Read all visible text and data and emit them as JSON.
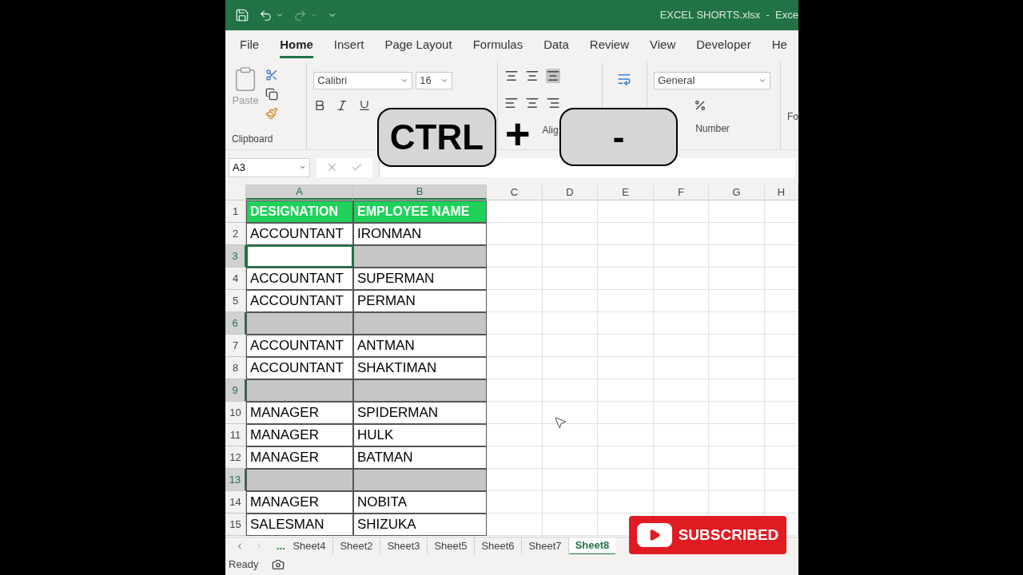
{
  "title_bar": {
    "title": "EXCEL SHORTS.xlsx  -  Exce"
  },
  "menu_tabs": [
    {
      "label": "File",
      "selected": false
    },
    {
      "label": "Home",
      "selected": true
    },
    {
      "label": "Insert",
      "selected": false
    },
    {
      "label": "Page Layout",
      "selected": false
    },
    {
      "label": "Formulas",
      "selected": false
    },
    {
      "label": "Data",
      "selected": false
    },
    {
      "label": "Review",
      "selected": false
    },
    {
      "label": "View",
      "selected": false
    },
    {
      "label": "Developer",
      "selected": false
    },
    {
      "label": "He",
      "selected": false
    }
  ],
  "ribbon": {
    "paste_label": "Paste",
    "font_name": "Calibri",
    "font_size": "16",
    "number_format": "General",
    "cut_off_label": "Fo",
    "groups": [
      "Clipboard",
      "Alig",
      "Number"
    ]
  },
  "formula_bar": {
    "name_box": "A3"
  },
  "columns": [
    {
      "label": "A",
      "selected": true
    },
    {
      "label": "B",
      "selected": true
    },
    {
      "label": "C",
      "selected": false
    },
    {
      "label": "D",
      "selected": false
    },
    {
      "label": "E",
      "selected": false
    },
    {
      "label": "F",
      "selected": false
    },
    {
      "label": "G",
      "selected": false
    },
    {
      "label": "H",
      "selected": false
    }
  ],
  "rows": [
    {
      "number": "1",
      "kind": "header",
      "selected": false,
      "active": false,
      "cells": [
        "DESIGNATION",
        "EMPLOYEE NAME"
      ]
    },
    {
      "number": "2",
      "kind": "data",
      "selected": false,
      "active": false,
      "cells": [
        "ACCOUNTANT",
        "IRONMAN"
      ]
    },
    {
      "number": "3",
      "kind": "data",
      "selected": true,
      "active": true,
      "cells": []
    },
    {
      "number": "4",
      "kind": "data",
      "selected": false,
      "active": false,
      "cells": [
        "ACCOUNTANT",
        "SUPERMAN"
      ]
    },
    {
      "number": "5",
      "kind": "data",
      "selected": false,
      "active": false,
      "cells": [
        "ACCOUNTANT",
        "PERMAN"
      ]
    },
    {
      "number": "6",
      "kind": "data",
      "selected": true,
      "active": false,
      "cells": []
    },
    {
      "number": "7",
      "kind": "data",
      "selected": false,
      "active": false,
      "cells": [
        "ACCOUNTANT",
        "ANTMAN"
      ]
    },
    {
      "number": "8",
      "kind": "data",
      "selected": false,
      "active": false,
      "cells": [
        "ACCOUNTANT",
        "SHAKTIMAN"
      ]
    },
    {
      "number": "9",
      "kind": "data",
      "selected": true,
      "active": false,
      "cells": []
    },
    {
      "number": "10",
      "kind": "data",
      "selected": false,
      "active": false,
      "cells": [
        "MANAGER",
        "SPIDERMAN"
      ]
    },
    {
      "number": "11",
      "kind": "data",
      "selected": false,
      "active": false,
      "cells": [
        "MANAGER",
        "HULK"
      ]
    },
    {
      "number": "12",
      "kind": "data",
      "selected": false,
      "active": false,
      "cells": [
        "MANAGER",
        "BATMAN"
      ]
    },
    {
      "number": "13",
      "kind": "data",
      "selected": true,
      "active": false,
      "cells": []
    },
    {
      "number": "14",
      "kind": "data",
      "selected": false,
      "active": false,
      "cells": [
        "MANAGER",
        "NOBITA"
      ]
    },
    {
      "number": "15",
      "kind": "data",
      "selected": false,
      "active": false,
      "cells": [
        "SALESMAN",
        "SHIZUKA"
      ]
    }
  ],
  "sheet_tabs": {
    "more": "...",
    "tabs": [
      {
        "label": "Sheet4",
        "selected": false
      },
      {
        "label": "Sheet2",
        "selected": false
      },
      {
        "label": "Sheet3",
        "selected": false
      },
      {
        "label": "Sheet5",
        "selected": false
      },
      {
        "label": "Sheet6",
        "selected": false
      },
      {
        "label": "Sheet7",
        "selected": false
      },
      {
        "label": "Sheet8",
        "selected": true
      }
    ]
  },
  "status_bar": {
    "text": "Ready"
  },
  "overlay": {
    "keys": [
      "CTRL",
      "-"
    ],
    "plus": "+",
    "subscribe": "SUBSCRIBED"
  }
}
